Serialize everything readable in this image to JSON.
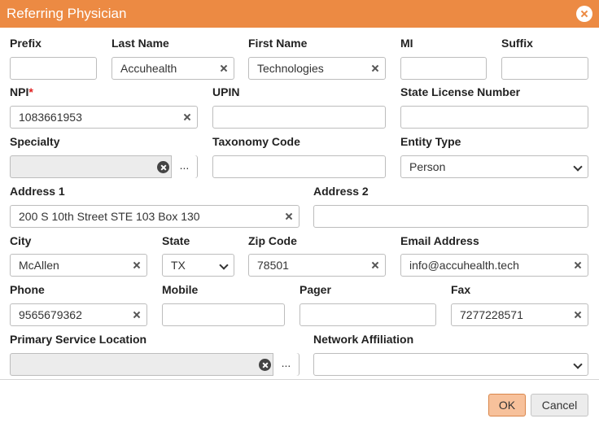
{
  "dialog": {
    "title": "Referring Physician"
  },
  "fields": {
    "prefix": {
      "label": "Prefix",
      "value": ""
    },
    "last_name": {
      "label": "Last Name",
      "value": "Accuhealth"
    },
    "first_name": {
      "label": "First Name",
      "value": "Technologies"
    },
    "mi": {
      "label": "MI",
      "value": ""
    },
    "suffix": {
      "label": "Suffix",
      "value": ""
    },
    "npi": {
      "label": "NPI",
      "required_mark": "*",
      "value": "1083661953"
    },
    "upin": {
      "label": "UPIN",
      "value": ""
    },
    "state_license": {
      "label": "State License Number",
      "value": ""
    },
    "specialty": {
      "label": "Specialty",
      "value": "",
      "browse": "..."
    },
    "taxonomy_code": {
      "label": "Taxonomy Code",
      "value": ""
    },
    "entity_type": {
      "label": "Entity Type",
      "value": "Person"
    },
    "address1": {
      "label": "Address 1",
      "value": "200 S 10th Street STE 103 Box 130"
    },
    "address2": {
      "label": "Address 2",
      "value": ""
    },
    "city": {
      "label": "City",
      "value": "McAllen"
    },
    "state": {
      "label": "State",
      "value": "TX"
    },
    "zip": {
      "label": "Zip Code",
      "value": "78501"
    },
    "email": {
      "label": "Email Address",
      "value": "info@accuhealth.tech"
    },
    "phone": {
      "label": "Phone",
      "value": "9565679362"
    },
    "mobile": {
      "label": "Mobile",
      "value": ""
    },
    "pager": {
      "label": "Pager",
      "value": ""
    },
    "fax": {
      "label": "Fax",
      "value": "7277228571"
    },
    "primary_service_location": {
      "label": "Primary Service Location",
      "value": "",
      "browse": "..."
    },
    "network_affiliation": {
      "label": "Network Affiliation",
      "value": ""
    }
  },
  "buttons": {
    "ok": "OK",
    "cancel": "Cancel"
  },
  "icons": {
    "close": "close-circle-icon",
    "clear": "clear-x-icon",
    "dropdown": "chevron-down-icon"
  },
  "colors": {
    "titlebar": "#ec8a43",
    "ok_button": "#f7c19b",
    "required": "#e02020"
  }
}
